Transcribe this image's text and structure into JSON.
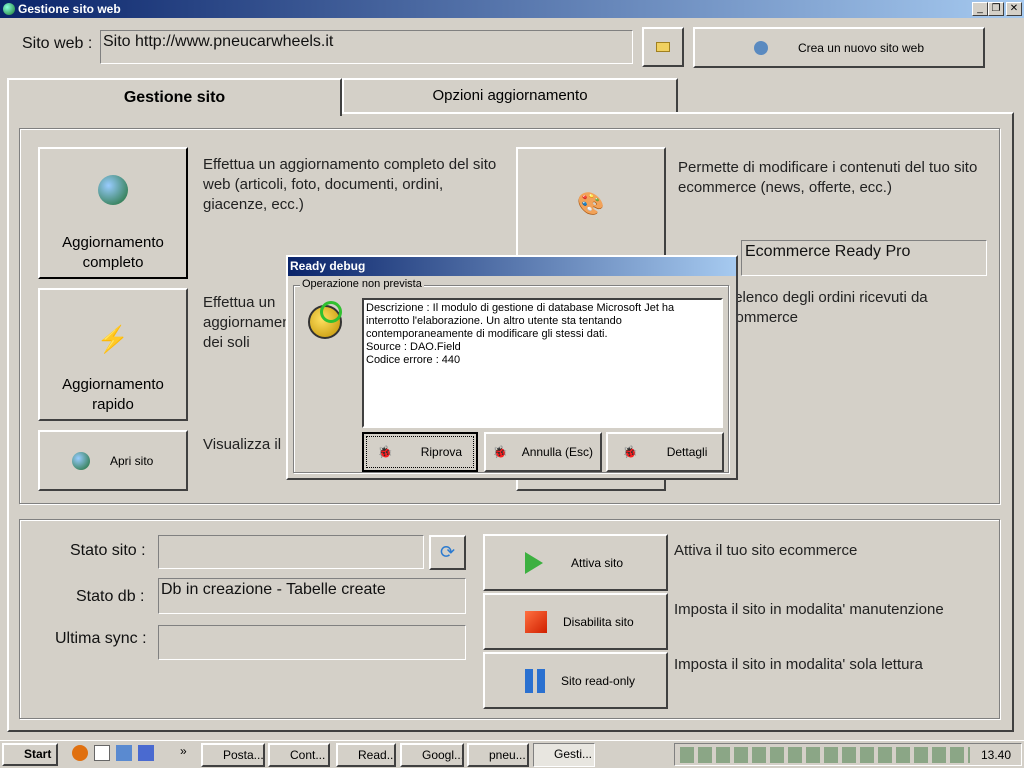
{
  "window": {
    "title": "Gestione sito web"
  },
  "header": {
    "site_label": "Sito web :",
    "site_value": "Sito http://www.pneucarwheels.it",
    "new_site_label": "Crea un nuovo sito web"
  },
  "tabs": [
    {
      "label": "Gestione sito"
    },
    {
      "label": "Opzioni aggiornamento"
    }
  ],
  "actions": {
    "full_update": {
      "label": "Aggiornamento completo",
      "desc": "Effettua un aggiornamento completo del sito web (articoli, foto, documenti, ordini, giacenze, ecc.)"
    },
    "quick_update": {
      "label": "Aggiornamento rapido",
      "desc": "Effettua un aggiornamento dei soli ordini registrati"
    },
    "open_site": {
      "label": "Apri sito",
      "desc": "Visualizza il"
    },
    "edit_content": {
      "desc": "Permette di modificare i contenuti del tuo sito ecommerce (news, offerte, ecc.)"
    },
    "product_value": "Ecommerce Ready Pro",
    "orders_desc": "l'elenco degli ordini ricevuti da commerce"
  },
  "status": {
    "site_label": "Stato sito :",
    "site_value": "",
    "db_label": "Stato db :",
    "db_value": "Db in creazione - Tabelle create",
    "sync_label": "Ultima sync :",
    "sync_value": "",
    "activate": {
      "label": "Attiva sito",
      "desc": "Attiva il tuo sito ecommerce"
    },
    "disable": {
      "label": "Disabilita sito",
      "desc": "Imposta il sito in modalita' manutenzione"
    },
    "readonly": {
      "label": "Sito read-only",
      "desc": "Imposta il sito in modalita' sola lettura"
    }
  },
  "dialog": {
    "title": "Ready debug",
    "group": "Operazione non prevista",
    "message_lines": [
      "Descrizione : Il modulo di gestione di database Microsoft Jet ha interrotto l'elaborazione. Un altro utente sta tentando contemporaneamente di modificare gli stessi dati.",
      "Source : DAO.Field",
      "Codice errore : 440"
    ],
    "retry": "Riprova",
    "cancel": "Annulla (Esc)",
    "details": "Dettagli"
  },
  "taskbar": {
    "start": "Start",
    "overflow": "»",
    "tasks": [
      "Posta...",
      "Cont...",
      "Read...",
      "Googl...",
      "pneu...",
      "Gesti..."
    ],
    "clock": "13.40"
  }
}
